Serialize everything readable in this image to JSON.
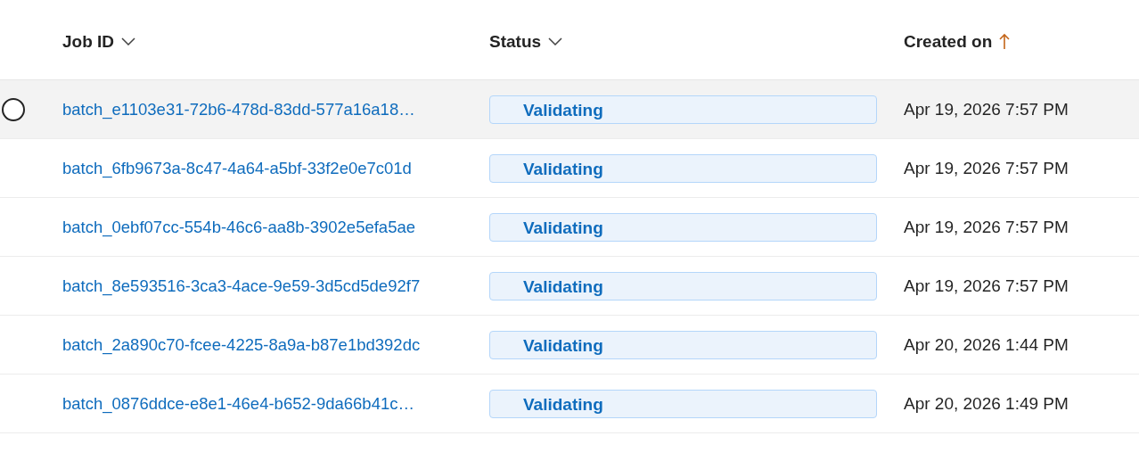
{
  "table": {
    "columns": [
      {
        "label": "Job ID",
        "kind": "menu"
      },
      {
        "label": "Status",
        "kind": "menu"
      },
      {
        "label": "Created on",
        "kind": "ascending"
      }
    ],
    "rows": [
      {
        "job_id": "batch_e1103e31-72b6-478d-83dd-577a16a18…",
        "status": "Validating",
        "created_on": "Apr 19, 2026 7:57 PM",
        "hovered": true,
        "selected": false
      },
      {
        "job_id": "batch_6fb9673a-8c47-4a64-a5bf-33f2e0e7c01d",
        "status": "Validating",
        "created_on": "Apr 19, 2026 7:57 PM",
        "hovered": false,
        "selected": false
      },
      {
        "job_id": "batch_0ebf07cc-554b-46c6-aa8b-3902e5efa5ae",
        "status": "Validating",
        "created_on": "Apr 19, 2026 7:57 PM",
        "hovered": false,
        "selected": false
      },
      {
        "job_id": "batch_8e593516-3ca3-4ace-9e59-3d5cd5de92f7",
        "status": "Validating",
        "created_on": "Apr 19, 2026 7:57 PM",
        "hovered": false,
        "selected": false
      },
      {
        "job_id": "batch_2a890c70-fcee-4225-8a9a-b87e1bd392dc",
        "status": "Validating",
        "created_on": "Apr 20, 2026 1:44 PM",
        "hovered": false,
        "selected": false
      },
      {
        "job_id": "batch_0876ddce-e8e1-46e4-b652-9da66b41c…",
        "status": "Validating",
        "created_on": "Apr 20, 2026 1:49 PM",
        "hovered": false,
        "selected": false
      }
    ]
  }
}
